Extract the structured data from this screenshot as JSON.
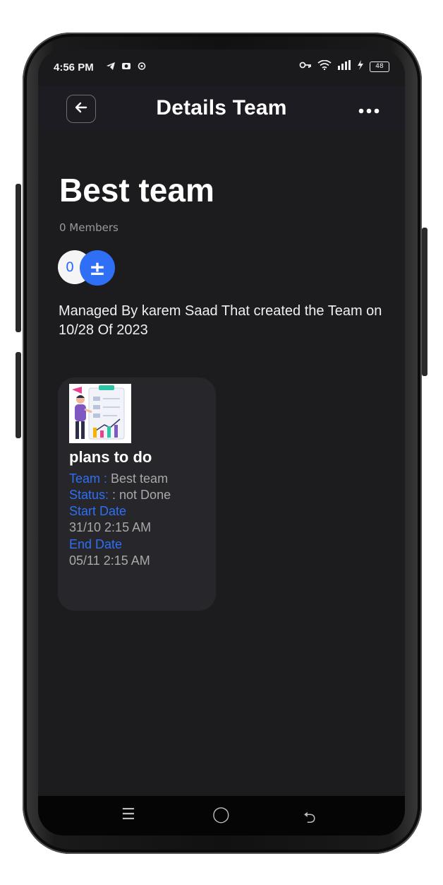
{
  "status_bar": {
    "time": "4:56 PM",
    "left_icons": [
      "telegram-icon",
      "camera-icon",
      "sync-icon"
    ],
    "right_icons": [
      "key-icon",
      "wifi-icon",
      "signal-icon",
      "charging-icon"
    ],
    "battery": "48"
  },
  "app_bar": {
    "title": "Details Team",
    "back_icon": "arrow-left-icon",
    "more_icon": "more-horizontal-icon"
  },
  "team": {
    "name": "Best team",
    "members_label": "0 Members",
    "member_count": "0",
    "add_symbol": "±",
    "managed_text": " Managed By karem Saad That created the Team on 10/28  Of 2023"
  },
  "plans": [
    {
      "title": "plans to do",
      "team_label": "Team : ",
      "team_value": "Best team",
      "status_label": "Status: ",
      "status_value": ": not Done",
      "start_label": "Start Date",
      "start_value": "31/10 2:15 AM",
      "end_label": "End Date",
      "end_value": "05/11 2:15 AM"
    }
  ],
  "nav_bar": {
    "menu_glyph": "☰",
    "home_glyph": "◯",
    "back_glyph": "⮌"
  },
  "colors": {
    "background": "#1c1c1e",
    "accent": "#2f6ff5",
    "card": "#26262b",
    "text": "#ffffff",
    "muted": "#a9a9a9"
  }
}
